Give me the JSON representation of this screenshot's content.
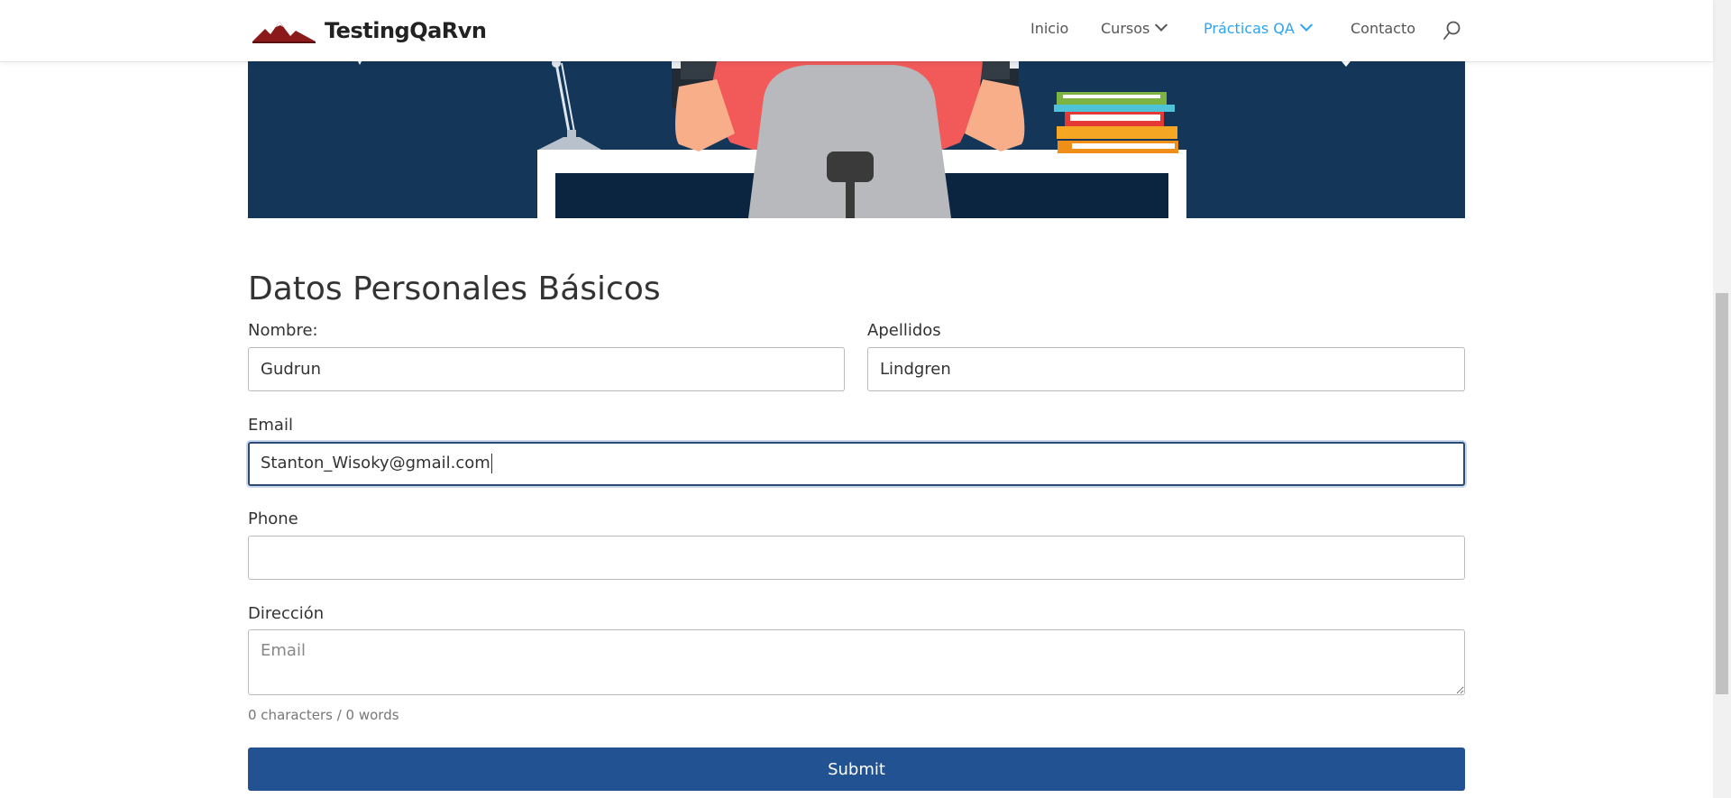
{
  "header": {
    "logo_text": "TestingQaRvn",
    "nav": [
      {
        "label": "Inicio"
      },
      {
        "label": "Cursos"
      },
      {
        "label": "Prácticas QA"
      },
      {
        "label": "Contacto"
      }
    ],
    "active_color": "#2ea3f2"
  },
  "form": {
    "title": "Datos Personales Básicos",
    "nombre_label": "Nombre:",
    "nombre_value": "Gudrun",
    "apellidos_label": "Apellidos",
    "apellidos_value": "Lindgren",
    "email_label": "Email",
    "email_value": "Stanton_Wisoky@gmail.com",
    "phone_label": "Phone",
    "phone_value": "",
    "direccion_label": "Dirección",
    "direccion_placeholder": "Email",
    "counter": "0 characters / 0 words",
    "submit_label": "Submit"
  },
  "colors": {
    "hero_bg": "#133659",
    "submit_bg": "#225292"
  }
}
